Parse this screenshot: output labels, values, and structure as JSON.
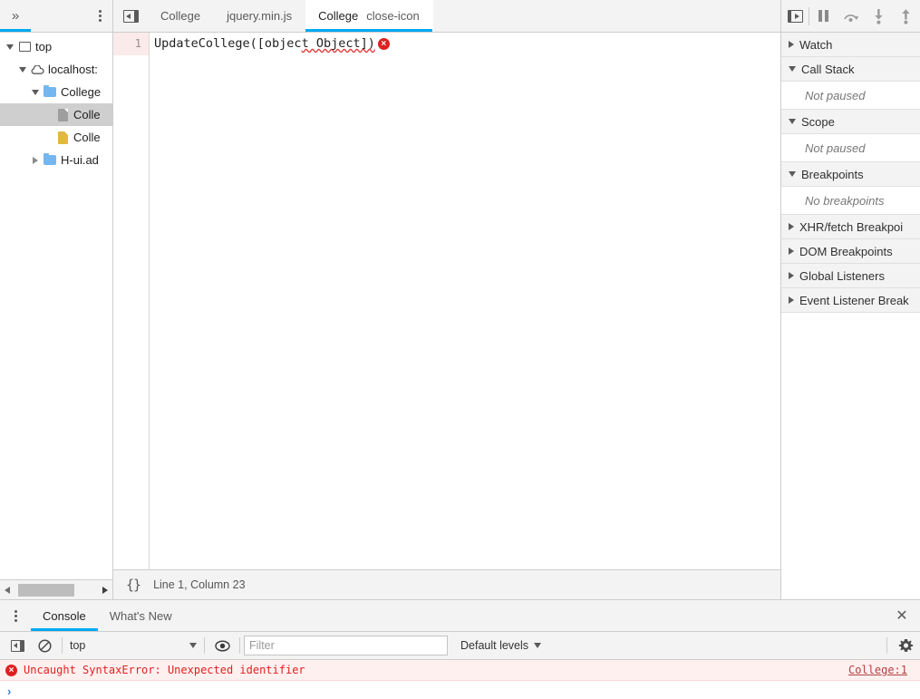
{
  "navigator": {
    "more_tabs_icon": "chevron-double-right-icon",
    "menu_icon": "vertical-dots-icon",
    "tree": [
      {
        "label": "top",
        "icon": "frame-icon",
        "twisty": "down",
        "indent": 0,
        "selected": false
      },
      {
        "label": "localhost:",
        "icon": "cloud-icon",
        "twisty": "down",
        "indent": 1,
        "selected": false
      },
      {
        "label": "College",
        "icon": "folder-icon",
        "twisty": "down",
        "indent": 2,
        "selected": false
      },
      {
        "label": "Colle",
        "icon": "document-icon",
        "twisty": "none",
        "indent": 3,
        "selected": true
      },
      {
        "label": "Colle",
        "icon": "js-file-icon",
        "twisty": "none",
        "indent": 3,
        "selected": false
      },
      {
        "label": "H-ui.ad",
        "icon": "folder-icon",
        "twisty": "right",
        "indent": 2,
        "selected": false
      }
    ],
    "scroll_left_icon": "scroll-left-arrow-icon",
    "scroll_right_icon": "scroll-right-arrow-icon"
  },
  "editor": {
    "panel_toggle_icon": "show-navigator-icon",
    "tabs": [
      {
        "label": "College",
        "active": false,
        "closable": false
      },
      {
        "label": "jquery.min.js",
        "active": false,
        "closable": false
      },
      {
        "label": "College",
        "active": true,
        "closable": true,
        "close_icon": "close-icon"
      }
    ],
    "line_number": "1",
    "code_prefix": "UpdateCollege([objec",
    "code_squiggle": "t Object])",
    "error_badge": "×",
    "format_icon": "{}",
    "cursor_position": "Line 1, Column 23"
  },
  "debugger": {
    "toolbar": [
      {
        "icon": "show-debugger-sidebar-icon",
        "name": "toggle-debugger-sidebar"
      },
      {
        "icon": "pause-icon",
        "name": "pause-script-execution"
      },
      {
        "icon": "step-over-icon",
        "name": "step-over-next-function-call"
      },
      {
        "icon": "step-into-icon",
        "name": "step-into-next-function-call"
      },
      {
        "icon": "step-out-icon",
        "name": "step-out-of-current-function"
      }
    ],
    "sections": [
      {
        "label": "Watch",
        "expanded": false,
        "empty_text": null
      },
      {
        "label": "Call Stack",
        "expanded": true,
        "empty_text": "Not paused"
      },
      {
        "label": "Scope",
        "expanded": true,
        "empty_text": "Not paused"
      },
      {
        "label": "Breakpoints",
        "expanded": true,
        "empty_text": "No breakpoints"
      },
      {
        "label": "XHR/fetch Breakpoi",
        "expanded": false,
        "empty_text": null
      },
      {
        "label": "DOM Breakpoints",
        "expanded": false,
        "empty_text": null
      },
      {
        "label": "Global Listeners",
        "expanded": false,
        "empty_text": null
      },
      {
        "label": "Event Listener Break",
        "expanded": false,
        "empty_text": null
      }
    ]
  },
  "drawer": {
    "menu_icon": "vertical-dots-icon",
    "tabs": [
      {
        "label": "Console",
        "active": true
      },
      {
        "label": "What's New",
        "active": false
      }
    ],
    "close_icon": "close-icon",
    "toolbar": {
      "sidebar_icon": "console-sidebar-icon",
      "clear_icon": "clear-console-icon",
      "context": "top",
      "eye_icon": "live-expression-icon",
      "filter_placeholder": "Filter",
      "filter_value": "",
      "levels": "Default levels",
      "settings_icon": "gear-icon"
    },
    "messages": [
      {
        "level": "error",
        "badge": "×",
        "text": "Uncaught SyntaxError: Unexpected identifier",
        "source_link": "College:1"
      }
    ],
    "prompt": "›"
  },
  "colors": {
    "accent": "#00a8f0",
    "error_red": "#e02020",
    "error_bg": "#fff0f0",
    "toolbar_bg": "#f3f3f3",
    "border": "#cdcdcd",
    "folder_blue": "#75b6f0",
    "js_yellow": "#e2b93d"
  }
}
